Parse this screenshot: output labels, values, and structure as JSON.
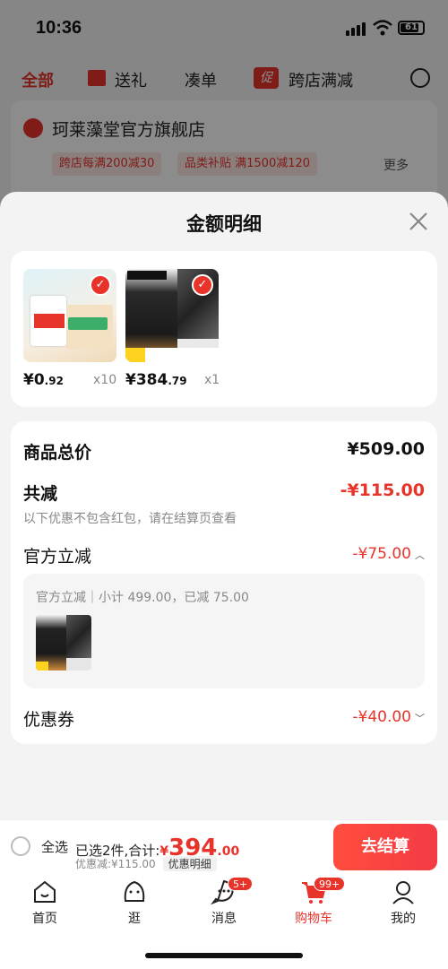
{
  "status": {
    "time": "10:36",
    "battery": "61"
  },
  "bg": {
    "tabs": [
      "全部",
      "送礼",
      "凑单",
      "跨店满减"
    ],
    "cu_icon": "促",
    "store_name": "珂莱藻堂官方旗舰店",
    "chips": [
      "跨店每满200减30",
      "品类补贴 满1500减120"
    ],
    "more": "更多"
  },
  "sheet": {
    "title": "金额明细",
    "items": [
      {
        "price_int": "¥0",
        "price_dec": ".92",
        "qty": "x10"
      },
      {
        "price_int": "¥384",
        "price_dec": ".79",
        "qty": "x1"
      }
    ],
    "total_label": "商品总价",
    "total_value": "¥509.00",
    "reduce_label": "共减",
    "reduce_value": "-¥115.00",
    "note": "以下优惠不包含红包，请在结算页查看",
    "official_label": "官方立减",
    "official_value": "-¥75.00",
    "sub_text": "官方立减｜小计 499.00，已减 75.00",
    "coupon_label": "优惠券",
    "coupon_value": "-¥40.00"
  },
  "checkout": {
    "select_all": "全选",
    "summary_prefix": "已选2件,合计:",
    "currency": "¥",
    "total_int": "394",
    "total_dec": ".00",
    "discount": "优惠减:¥115.00",
    "detail_tag": "优惠明细",
    "pay_label": "去结算"
  },
  "tabbar": [
    {
      "label": "首页",
      "badge": ""
    },
    {
      "label": "逛",
      "badge": ""
    },
    {
      "label": "消息",
      "badge": "5+"
    },
    {
      "label": "购物车",
      "badge": "99+"
    },
    {
      "label": "我的",
      "badge": ""
    }
  ],
  "colors": {
    "accent": "#e8332a"
  }
}
